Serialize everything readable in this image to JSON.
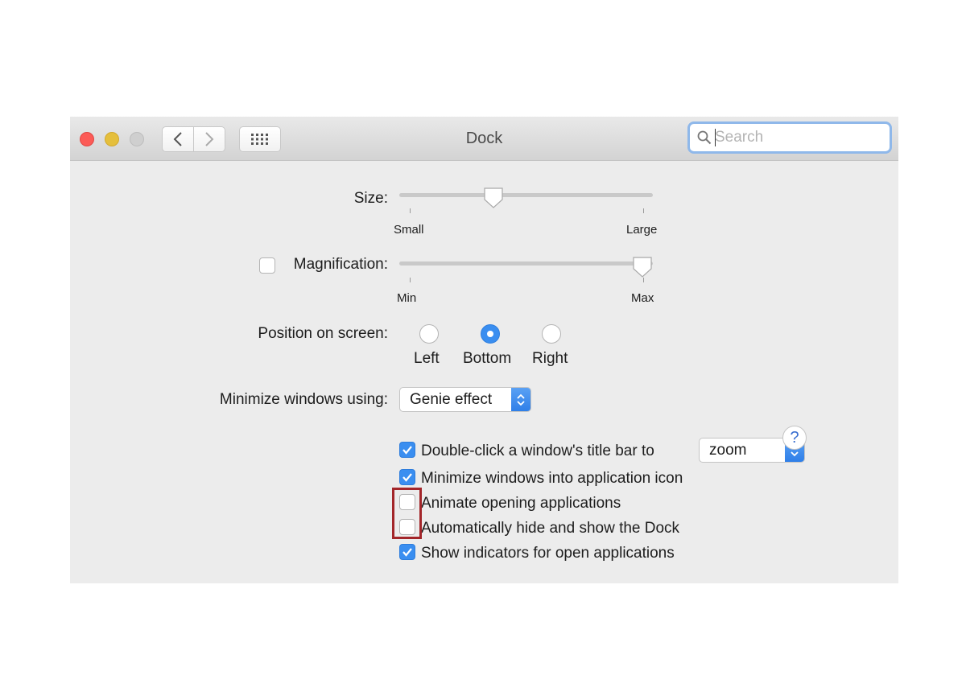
{
  "window": {
    "title": "Dock"
  },
  "toolbar": {
    "back_icon": "chevron-left-icon",
    "forward_icon": "chevron-right-icon",
    "show_all_icon": "grid-icon",
    "search_placeholder": "Search",
    "search_icon": "search-icon"
  },
  "size": {
    "label": "Size:",
    "min_label": "Small",
    "max_label": "Large",
    "value": 0.36
  },
  "magnification": {
    "label": "Magnification:",
    "min_label": "Min",
    "max_label": "Max",
    "value": 1.0,
    "checked": false
  },
  "position": {
    "label": "Position on screen:",
    "options": [
      {
        "label": "Left",
        "selected": false
      },
      {
        "label": "Bottom",
        "selected": true
      },
      {
        "label": "Right",
        "selected": false
      }
    ]
  },
  "minimize_effect": {
    "label": "Minimize windows using:",
    "selected": "Genie effect"
  },
  "double_click": {
    "label": "Double-click a window's title bar to",
    "checked": true,
    "action": "zoom"
  },
  "checkboxes": [
    {
      "label": "Minimize windows into application icon",
      "checked": true
    },
    {
      "label": "Animate opening applications",
      "checked": false
    },
    {
      "label": "Automatically hide and show the Dock",
      "checked": false
    },
    {
      "label": "Show indicators for open applications",
      "checked": true
    }
  ],
  "help": {
    "label": "?"
  },
  "colors": {
    "accent": "#3a8ef0",
    "highlight_box": "#a3262a",
    "window_bg": "#ececec"
  }
}
